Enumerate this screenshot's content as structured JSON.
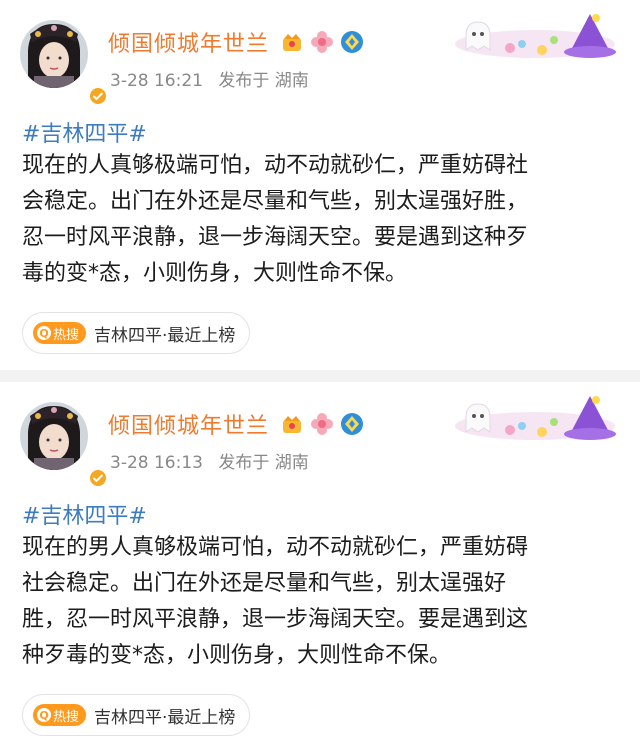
{
  "posts": [
    {
      "username": "倾国倾城年世兰",
      "time": "3-28 16:21",
      "location": "发布于 湖南",
      "hashtag": "#吉林四平#",
      "lines": [
        "现在的人真够极端可怕，动不动就砂仁，严重妨碍社",
        "会稳定。出门在外还是尽量和气些，别太逞强好胜，",
        "忍一时风平浪静，退一步海阔天空。要是遇到这种歹",
        "毒的变*态，小则伤身，大则性命不保。"
      ],
      "hot_badge": "热搜",
      "hot_tag": "吉林四平·最近上榜"
    },
    {
      "username": "倾国倾城年世兰",
      "time": "3-28 16:13",
      "location": "发布于 湖南",
      "hashtag": "#吉林四平#",
      "lines": [
        "现在的男人真够极端可怕，动不动就砂仁，严重妨碍",
        "社会稳定。出门在外还是尽量和气些，别太逞强好",
        "胜，忍一时风平浪静，退一步海阔天空。要是遇到这",
        "种歹毒的变*态，小则伤身，大则性命不保。"
      ],
      "hot_badge": "热搜",
      "hot_tag": "吉林四平·最近上榜"
    }
  ],
  "colors": {
    "username": "#f07a2e",
    "hashtag": "#3d7cbf",
    "hot_badge": "#ff9a1f",
    "meta": "#888888"
  },
  "icons": [
    "avatar",
    "verified-badge-icon",
    "crown-badge-icon",
    "flower-badge-icon",
    "vip-diamond-icon",
    "halloween-decoration"
  ]
}
